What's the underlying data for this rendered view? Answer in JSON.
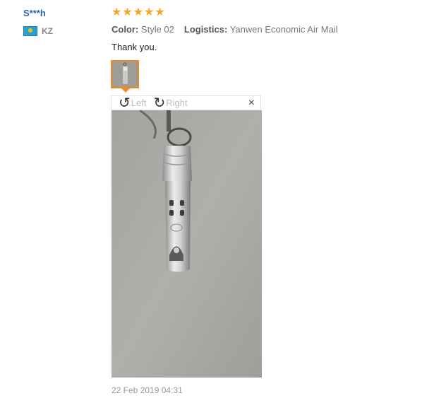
{
  "review": {
    "user_name": "S***h",
    "country": "KZ",
    "rating_stars": 5,
    "color_label": "Color:",
    "color_value": "Style 02",
    "logistics_label": "Logistics:",
    "logistics_value": "Yanwen Economic Air Mail",
    "feedback": "Thank you.",
    "date": "22 Feb 2019 04:31"
  },
  "viewer": {
    "rotate_left_label": "Left",
    "rotate_right_label": "Right",
    "close_glyph": "×",
    "rotate_left_icon": "rotate-left-icon",
    "rotate_right_icon": "rotate-right-icon",
    "close_icon": "close-icon"
  },
  "colors": {
    "accent_orange": "#f08a1f",
    "star": "#f7a520",
    "user_link": "#2a62b3"
  }
}
